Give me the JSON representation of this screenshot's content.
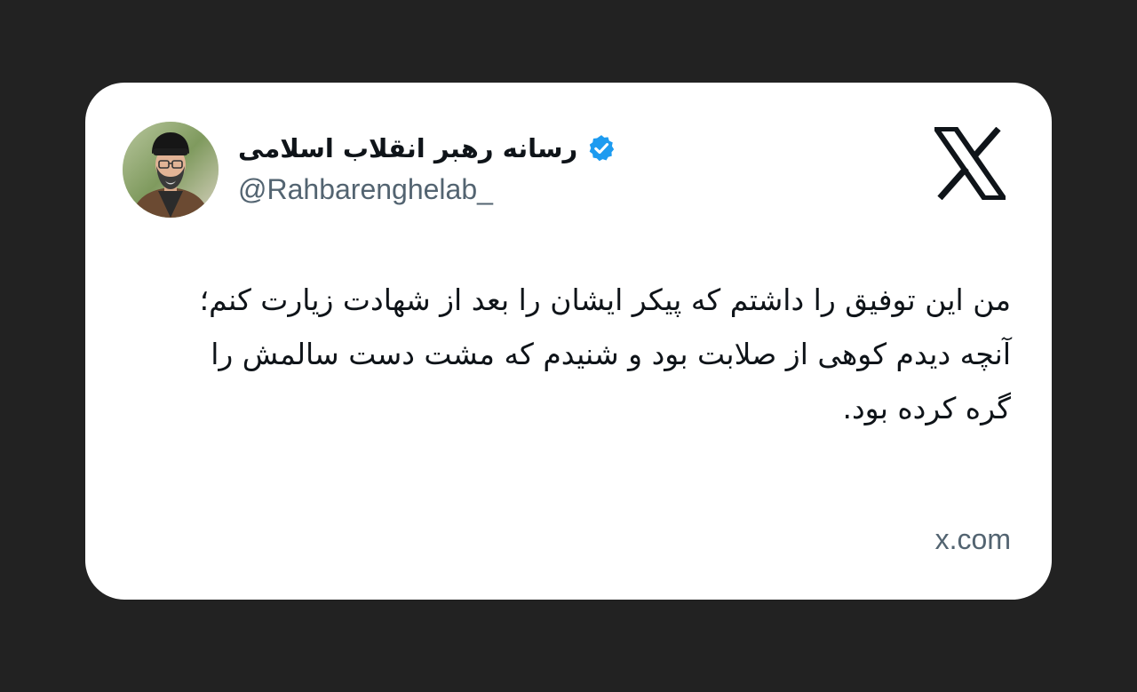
{
  "tweet": {
    "author": {
      "display_name": "رسانه رهبر انقلاب اسلامی",
      "handle": "@Rahbarenghelab_",
      "verified": true,
      "verified_color": "#1d9bf0"
    },
    "platform_logo": "x-logo-icon",
    "text": "من این توفیق را داشتم که پیکر ایشان را بعد از شهادت زیارت کنم؛ آنچه دیدم کوهی از صلابت بود و شنیدم که مشت دست سالمش را گره کرده بود.",
    "source_domain": "x.com"
  },
  "colors": {
    "page_background": "#222222",
    "card_background": "#ffffff",
    "primary_text": "#0f1419",
    "secondary_text": "#536471"
  }
}
